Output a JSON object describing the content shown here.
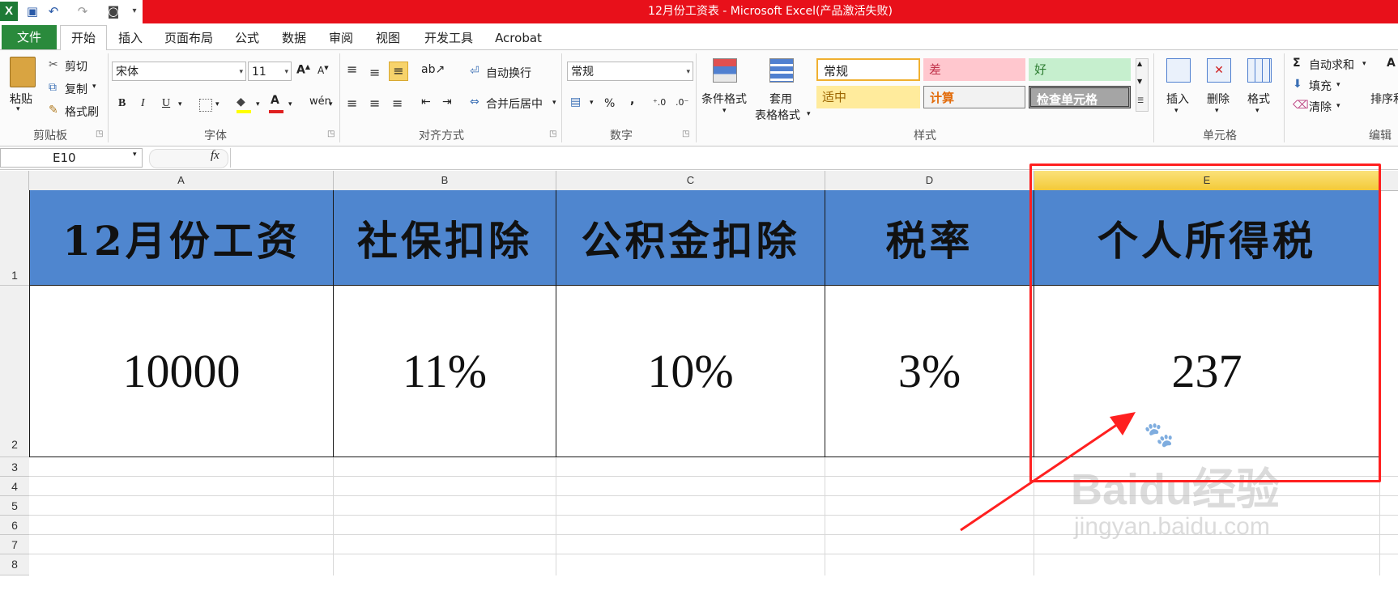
{
  "window": {
    "title": "12月份工资表 - Microsoft Excel(产品激活失败)",
    "qat_icons": [
      "excel-logo-icon",
      "save-icon",
      "undo-icon",
      "redo-icon",
      "camera-icon",
      "customize-qat-icon"
    ]
  },
  "tabs": [
    "文件",
    "开始",
    "插入",
    "页面布局",
    "公式",
    "数据",
    "审阅",
    "视图",
    "开发工具",
    "Acrobat"
  ],
  "ribbon": {
    "clipboard": {
      "paste": "粘贴",
      "cut": "剪切",
      "copy": "复制",
      "format_painter": "格式刷",
      "group": "剪贴板"
    },
    "font": {
      "font_name": "宋体",
      "font_size": "11",
      "bold": "B",
      "italic": "I",
      "underline": "U",
      "group": "字体"
    },
    "alignment": {
      "wrap": "自动换行",
      "merge": "合并后居中",
      "group": "对齐方式"
    },
    "number": {
      "format": "常规",
      "percent": "%",
      "comma": ",",
      "group": "数字"
    },
    "styles": {
      "conditional": "条件格式",
      "table_format_1": "套用",
      "table_format_2": "表格格式",
      "group": "样式",
      "cells": [
        {
          "label": "常规",
          "bg": "#ffffff",
          "color": "#222222"
        },
        {
          "label": "差",
          "bg": "#ffc7ce",
          "color": "#c0324a"
        },
        {
          "label": "好",
          "bg": "#c6efce",
          "color": "#2e7d32"
        },
        {
          "label": "适中",
          "bg": "#ffeb9c",
          "color": "#9c6500"
        },
        {
          "label": "计算",
          "bg": "#f2f2f2",
          "color": "#e26b0a"
        },
        {
          "label": "检查单元格",
          "bg": "#a5a5a5",
          "color": "#ffffff"
        }
      ]
    },
    "cells": {
      "insert": "插入",
      "delete": "删除",
      "format": "格式",
      "group": "单元格"
    },
    "editing": {
      "autosum": "自动求和",
      "fill": "填充",
      "clear": "清除",
      "sort": "排序和",
      "group": "编辑"
    }
  },
  "formula_bar": {
    "name_box": "E10",
    "fx": "fx",
    "formula": ""
  },
  "sheet": {
    "columns": [
      "A",
      "B",
      "C",
      "D",
      "E"
    ],
    "rows": [
      "1",
      "2",
      "3",
      "4",
      "5",
      "6",
      "7",
      "8"
    ],
    "headers": [
      "12月份工资",
      "社保扣除",
      "公积金扣除",
      "税率",
      "个人所得税"
    ],
    "values": [
      "10000",
      "11%",
      "10%",
      "3%",
      "237"
    ],
    "header_fill": "#4f86cf",
    "selected_column": "E",
    "highlight_color": "#ff2020"
  },
  "watermark": {
    "line1": "Baidu经验",
    "line2": "jingyan.baidu.com"
  }
}
